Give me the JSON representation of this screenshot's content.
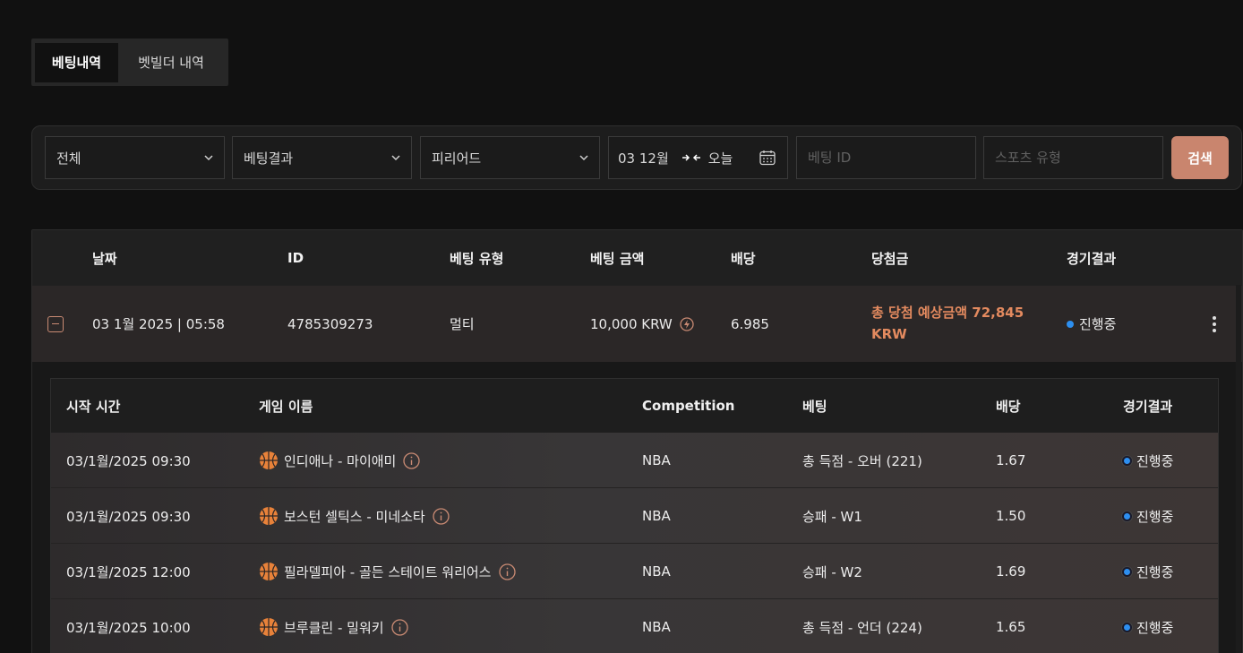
{
  "tabs": [
    {
      "label": "베팅내역",
      "active": true
    },
    {
      "label": "벳빌더 내역",
      "active": false
    }
  ],
  "filters": {
    "all": "전체",
    "result": "베팅결과",
    "period": "피리어드",
    "date_from": "03 12월",
    "date_to": "오늘",
    "bet_id_placeholder": "베팅 ID",
    "sport_placeholder": "스포츠 유형",
    "search_label": "검색"
  },
  "table": {
    "headers": {
      "date": "날짜",
      "id": "ID",
      "type": "베팅 유형",
      "amount": "베팅 금액",
      "odds": "배당",
      "winnings": "당첨금",
      "result": "경기결과"
    },
    "row": {
      "date": "03 1월 2025 | 05:58",
      "id": "4785309273",
      "type": "멀티",
      "amount": "10,000 KRW",
      "odds": "6.985",
      "winnings_line1": "총 당첨 예상금액 72,845",
      "winnings_line2": "KRW",
      "status": "진행중"
    }
  },
  "subtable": {
    "headers": {
      "start": "시작 시간",
      "game": "게임 이름",
      "competition": "Competition",
      "bet": "베팅",
      "odds": "배당",
      "result": "경기결과"
    },
    "rows": [
      {
        "start": "03/1월/2025 09:30",
        "game": "인디애나 - 마이애미",
        "competition": "NBA",
        "bet": "총 득점 - 오버 (221)",
        "odds": "1.67",
        "status": "진행중"
      },
      {
        "start": "03/1월/2025 09:30",
        "game": "보스턴 셀틱스 - 미네소타",
        "competition": "NBA",
        "bet": "승패 - W1",
        "odds": "1.50",
        "status": "진행중"
      },
      {
        "start": "03/1월/2025 12:00",
        "game": "필라델피아 - 골든 스테이트 워리어스",
        "competition": "NBA",
        "bet": "승패 - W2",
        "odds": "1.69",
        "status": "진행중"
      },
      {
        "start": "03/1월/2025 10:00",
        "game": "브루클린 - 밀워키",
        "competition": "NBA",
        "bet": "총 득점 - 언더 (224)",
        "odds": "1.65",
        "status": "진행중"
      }
    ]
  },
  "colors": {
    "accent": "#c9856e",
    "winnings": "#e38a5f",
    "status_dot": "#2d8ff0",
    "ball": "#e8823a"
  }
}
